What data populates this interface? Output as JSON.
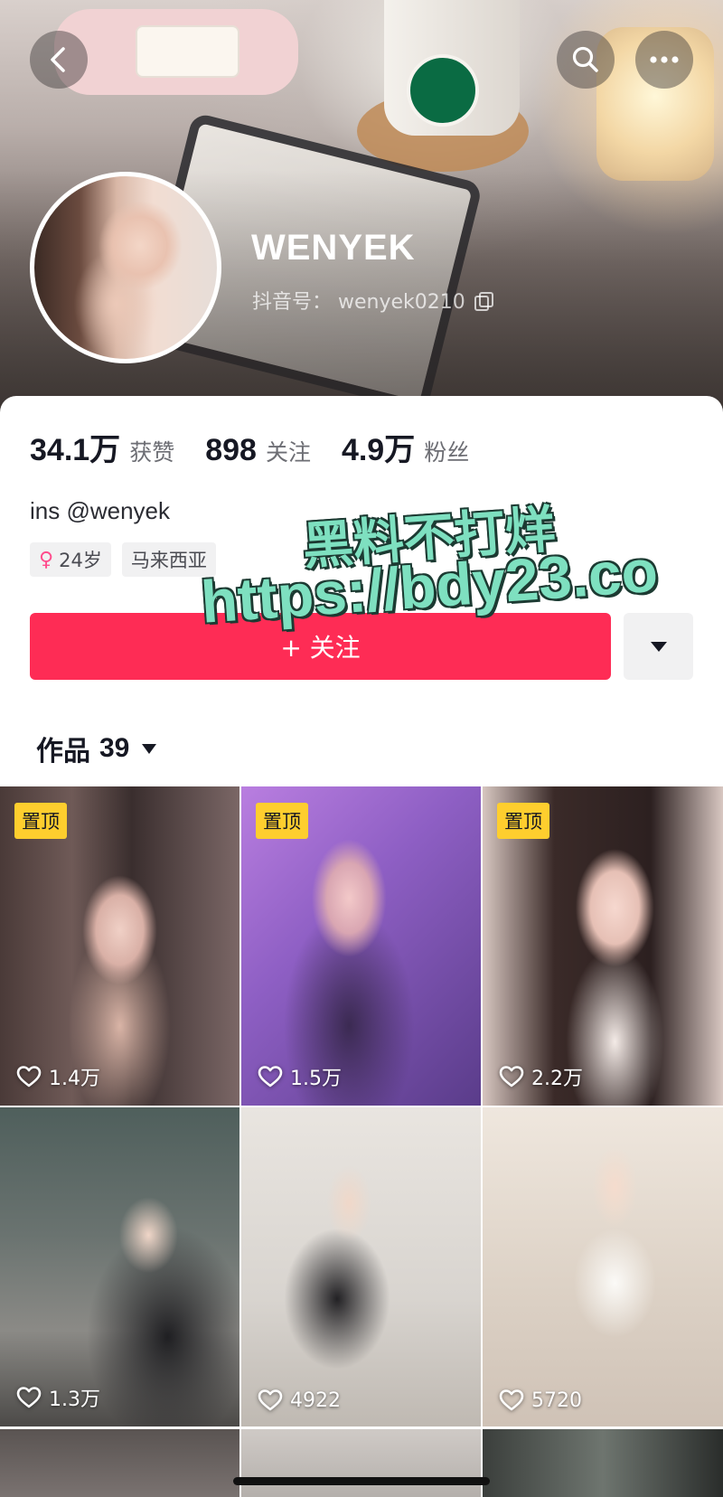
{
  "profile": {
    "username": "WENYEK",
    "douyin_id": "抖音号： wenyek0210",
    "bio": "ins @wenyek",
    "tags": {
      "age": "24岁",
      "location": "马来西亚"
    }
  },
  "stats": [
    {
      "value": "34.1万",
      "label": "获赞"
    },
    {
      "value": "898",
      "label": "关注"
    },
    {
      "value": "4.9万",
      "label": "粉丝"
    }
  ],
  "actions": {
    "follow_label": "+ 关注"
  },
  "watermark": {
    "line1": "黑料不打烊",
    "line2": "https://bdy23.co"
  },
  "works_tab": {
    "label": "作品",
    "count": "39"
  },
  "videos": [
    {
      "pinned_label": "置顶",
      "likes": "1.4万"
    },
    {
      "pinned_label": "置顶",
      "likes": "1.5万"
    },
    {
      "pinned_label": "置顶",
      "likes": "2.2万"
    },
    {
      "pinned_label": "",
      "likes": "1.3万"
    },
    {
      "pinned_label": "",
      "likes": "4922"
    },
    {
      "pinned_label": "",
      "likes": "5720"
    }
  ],
  "icons": {
    "back": "chevron-left-icon",
    "search": "search-icon",
    "more": "more-dots-icon",
    "copy": "copy-icon",
    "female": "female-icon",
    "like": "heart-outline-icon",
    "dropdown": "caret-down-icon"
  },
  "colors": {
    "accent": "#fe2c55",
    "pin_badge": "#fece2e",
    "watermark": "#7ee0c0"
  }
}
